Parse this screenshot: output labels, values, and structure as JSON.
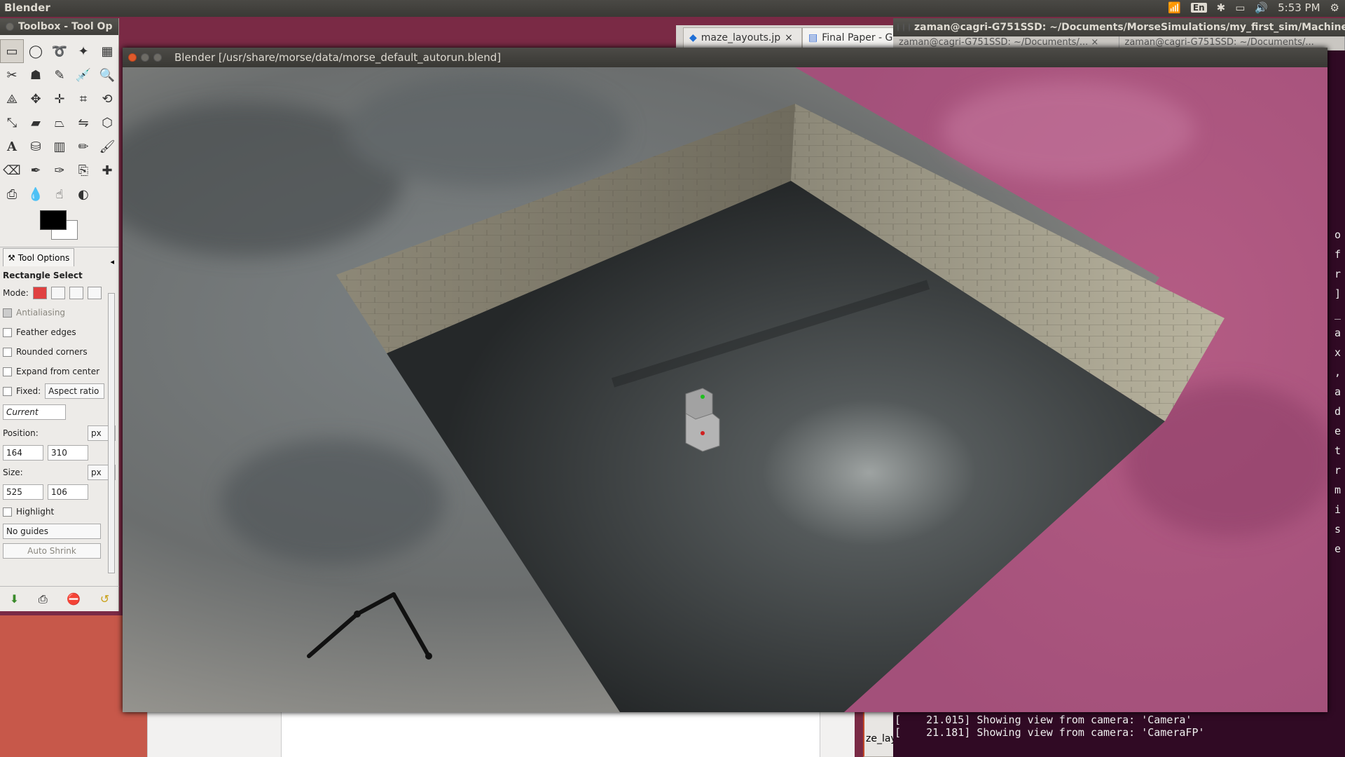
{
  "panel": {
    "app_name": "Blender",
    "lang": "En",
    "clock": "5:53 PM"
  },
  "gimp": {
    "title": "Toolbox - Tool Op",
    "tab_label": "Tool Options",
    "tool_name": "Rectangle Select",
    "mode_label": "Mode:",
    "antialiasing": "Antialiasing",
    "feather": "Feather edges",
    "rounded": "Rounded corners",
    "expand": "Expand from center",
    "fixed": "Fixed:",
    "fixed_value": "Aspect ratio",
    "current": "Current",
    "position_label": "Position:",
    "position_unit": "px",
    "pos_x": "164",
    "pos_y": "310",
    "size_label": "Size:",
    "size_unit": "px",
    "size_w": "525",
    "size_h": "106",
    "highlight": "Highlight",
    "guides": "No guides",
    "auto_shrink": "Auto Shrink"
  },
  "browser": {
    "tab1": "maze_layouts.jp",
    "tab2": "Final Paper - Go"
  },
  "terminal": {
    "title": "zaman@cagri-G751SSD: ~/Documents/MorseSimulations/my_first_sim/Machine",
    "tab1": "zaman@cagri-G751SSD: ~/Documents/...",
    "tab2": "zaman@cagri-G751SSD: ~/Documents/...",
    "line1": "[    21.015] Showing view from camera: 'Camera'",
    "line2": "[    21.181] Showing view from camera: 'CameraFP'",
    "edge_chars": [
      "o",
      "f",
      "r",
      "]",
      "_",
      "a",
      "x",
      ",",
      "a",
      "d",
      "e",
      "t",
      "r",
      "m",
      "i",
      "s",
      "e"
    ]
  },
  "background_doc": {
    "tab_fragment": "ze_lay"
  },
  "blender": {
    "title": "Blender [/usr/share/morse/data/morse_default_autorun.blend]"
  }
}
